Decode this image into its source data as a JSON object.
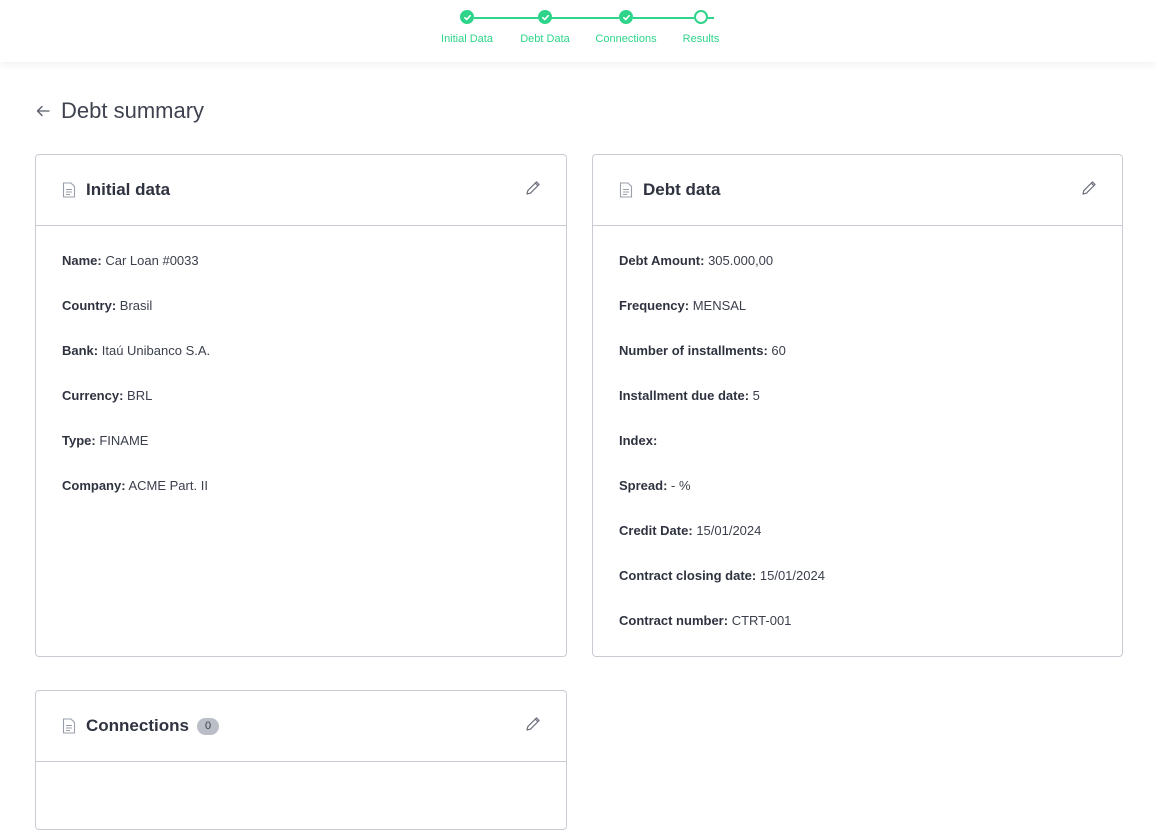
{
  "stepper": {
    "steps": [
      {
        "label": "Initial Data",
        "state": "done"
      },
      {
        "label": "Debt Data",
        "state": "done"
      },
      {
        "label": "Connections",
        "state": "done"
      },
      {
        "label": "Results",
        "state": "current"
      }
    ],
    "accent_color": "#2ed48a"
  },
  "header": {
    "back_icon": "arrow-left-icon",
    "title": "Debt summary"
  },
  "initial_card": {
    "title": "Initial data",
    "fields": [
      {
        "label": "Name:",
        "value": "Car Loan #0033"
      },
      {
        "label": "Country:",
        "value": "Brasil"
      },
      {
        "label": "Bank:",
        "value": "Itaú Unibanco S.A."
      },
      {
        "label": "Currency:",
        "value": "BRL"
      },
      {
        "label": "Type:",
        "value": "FINAME"
      },
      {
        "label": "Company:",
        "value": "ACME Part. II"
      }
    ]
  },
  "debt_card": {
    "title": "Debt data",
    "fields": [
      {
        "label": "Debt Amount:",
        "value": "305.000,00"
      },
      {
        "label": "Frequency:",
        "value": "MENSAL"
      },
      {
        "label": "Number of installments:",
        "value": "60"
      },
      {
        "label": "Installment due date:",
        "value": "5"
      },
      {
        "label": "Index:",
        "value": ""
      },
      {
        "label": "Spread:",
        "value": "- %"
      },
      {
        "label": "Credit Date:",
        "value": "15/01/2024"
      },
      {
        "label": "Contract closing date:",
        "value": "15/01/2024"
      },
      {
        "label": "Contract number:",
        "value": "CTRT-001"
      }
    ]
  },
  "connections_card": {
    "title": "Connections",
    "count": "0"
  }
}
